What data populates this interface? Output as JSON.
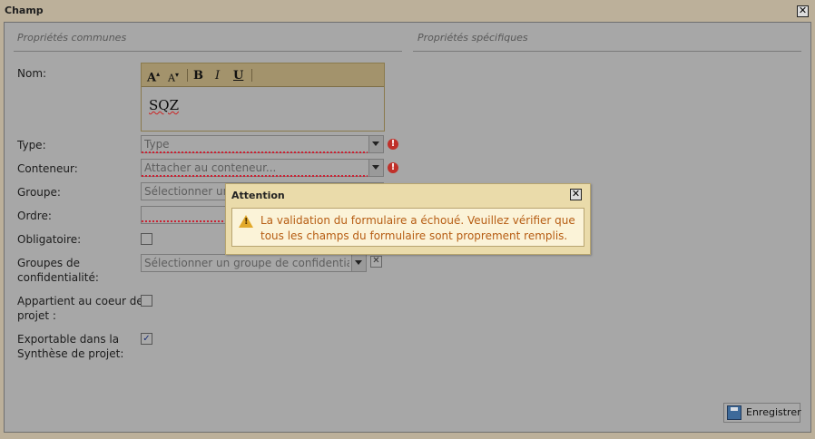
{
  "window": {
    "title": "Champ"
  },
  "sections": {
    "common": "Propriétés communes",
    "specific": "Propriétés spécifiques"
  },
  "fields": {
    "nom": {
      "label": "Nom:",
      "value": "SQZ"
    },
    "type": {
      "label": "Type:",
      "placeholder": "Type"
    },
    "conteneur": {
      "label": "Conteneur:",
      "placeholder": "Attacher au conteneur..."
    },
    "groupe": {
      "label": "Groupe:",
      "placeholder": "Sélectionner un"
    },
    "ordre": {
      "label": "Ordre:",
      "value": ""
    },
    "obligatoire": {
      "label": "Obligatoire:",
      "checked": false
    },
    "groupes_conf": {
      "label_line1": "Groupes de",
      "label_line2": "confidentialité:",
      "placeholder": "Sélectionner un groupe de confidentialité"
    },
    "coeur": {
      "label_line1": "Appartient au coeur de",
      "label_line2": "projet :",
      "checked": false
    },
    "exportable": {
      "label_line1": "Exportable dans la",
      "label_line2": "Synthèse de projet:",
      "checked": true
    }
  },
  "toolbar": {
    "grow_font": "A",
    "shrink_font": "A",
    "bold": "B",
    "italic": "I",
    "underline": "U"
  },
  "buttons": {
    "save": "Enregistrer"
  },
  "popup": {
    "title": "Attention",
    "message": "La validation du formulaire a échoué. Veuillez vérifier que tous les champs du formulaire sont proprement remplis."
  },
  "icons": {
    "close": "close-icon",
    "error": "error-icon",
    "warning": "warning-icon",
    "save": "save-icon",
    "checkmark": "checkmark-icon"
  },
  "colors": {
    "error": "#c0302a",
    "warning_text": "#b65c12",
    "popup_bg": "#eadbaa"
  }
}
